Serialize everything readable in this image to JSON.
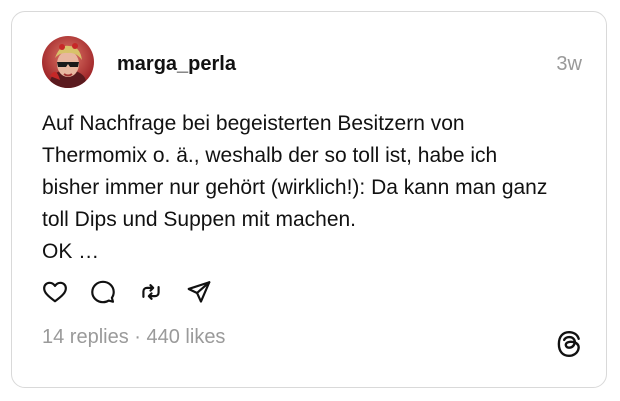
{
  "post": {
    "username": "marga_perla",
    "timestamp": "3w",
    "text_lines": [
      "Auf Nachfrage bei begeisterten Besitzern von",
      "Thermomix o. ä., weshalb der so toll ist, habe ich",
      "bisher immer nur gehört (wirklich!): Da kann man ganz",
      "toll Dips und Suppen mit machen.",
      "OK …"
    ],
    "stats": {
      "replies": "14 replies",
      "separator": " · ",
      "likes": "440 likes"
    },
    "actions": [
      "heart-icon",
      "comment-icon",
      "repost-icon",
      "share-icon"
    ],
    "brand_icon": "threads-logo-icon"
  },
  "colors": {
    "text": "#111111",
    "muted": "#999999",
    "border": "#d9d9d9",
    "background": "#ffffff"
  }
}
